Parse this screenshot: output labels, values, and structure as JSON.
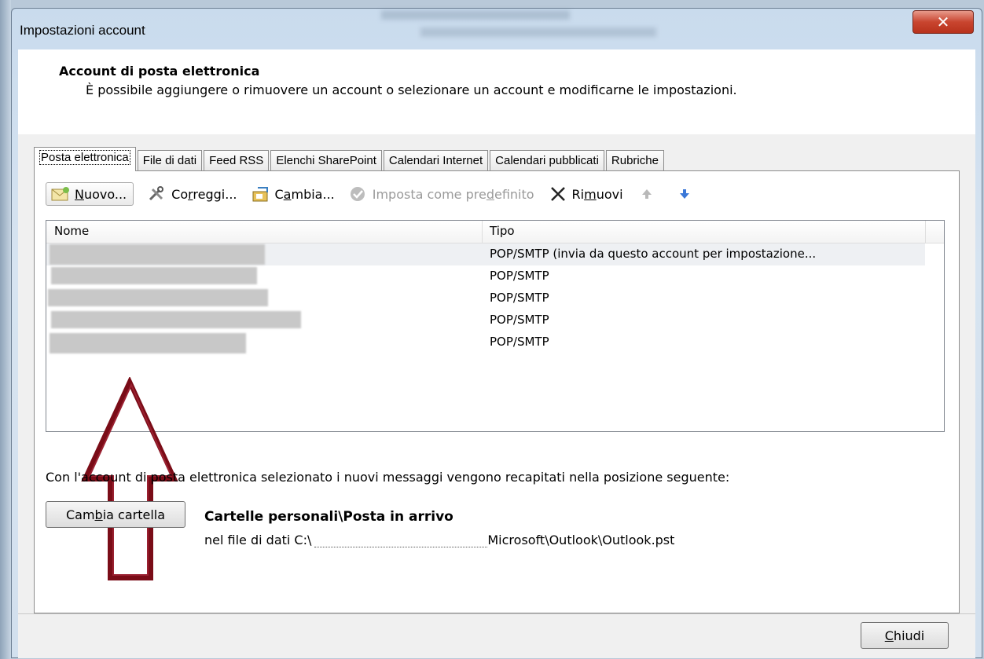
{
  "window": {
    "title": "Impostazioni account",
    "close_glyph": "✕"
  },
  "header": {
    "title": "Account di posta elettronica",
    "description": "È possibile aggiungere o rimuovere un account o selezionare un account e modificarne le impostazioni."
  },
  "tabs": [
    {
      "label": "Posta elettronica"
    },
    {
      "label": "File di dati"
    },
    {
      "label": "Feed RSS"
    },
    {
      "label": "Elenchi SharePoint"
    },
    {
      "label": "Calendari Internet"
    },
    {
      "label": "Calendari pubblicati"
    },
    {
      "label": "Rubriche"
    }
  ],
  "toolbar": {
    "new_pre": "",
    "new_u": "N",
    "new_post": "uovo...",
    "repair_pre": "Co",
    "repair_u": "r",
    "repair_post": "reggi...",
    "change_pre": "C",
    "change_u": "a",
    "change_post": "mbia...",
    "default_pre": "Imposta come pre",
    "default_u": "d",
    "default_post": "efinito",
    "remove_pre": "Ri",
    "remove_u": "m",
    "remove_post": "uovi"
  },
  "list": {
    "col_name": "Nome",
    "col_type": "Tipo",
    "rows": [
      {
        "type": "POP/SMTP (invia da questo account per impostazione..."
      },
      {
        "type": "POP/SMTP"
      },
      {
        "type": "POP/SMTP"
      },
      {
        "type": "POP/SMTP"
      },
      {
        "type": "POP/SMTP"
      }
    ]
  },
  "delivery": {
    "info": "Con l'account di posta elettronica selezionato i nuovi messaggi vengono recapitati nella posizione seguente:",
    "change_folder_pre": "Cam",
    "change_folder_u": "b",
    "change_folder_post": "ia cartella",
    "folder": "Cartelle personali\\Posta in arrivo",
    "file_prefix": "nel file di dati C:\\",
    "file_suffix": "Microsoft\\Outlook\\Outlook.pst"
  },
  "footer": {
    "close_u": "C",
    "close_post": "hiudi"
  },
  "colors": {
    "arrow": "#7a0c17",
    "close_button": "#c9452f"
  }
}
